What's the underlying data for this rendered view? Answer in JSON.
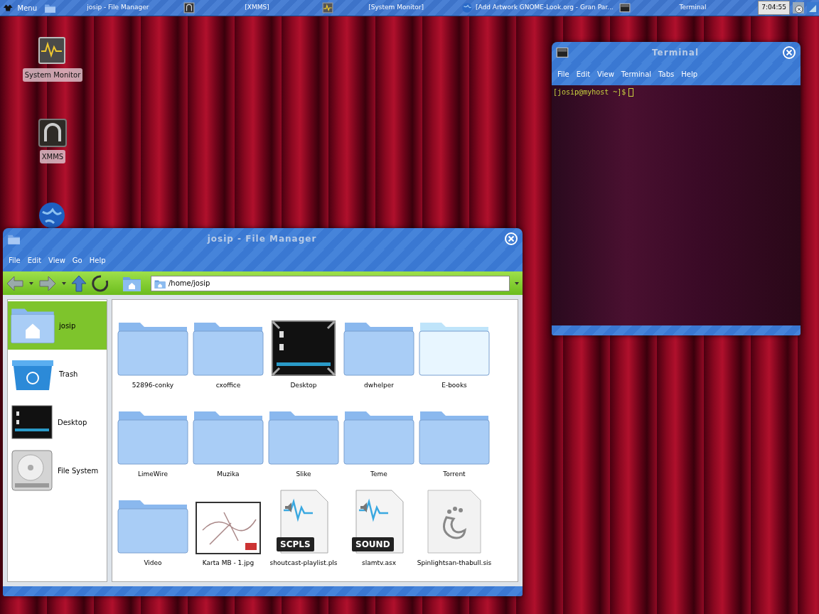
{
  "taskbar": {
    "menu": "Menu",
    "tasks": [
      {
        "label": "josip - File Manager"
      },
      {
        "label": "[XMMS]"
      },
      {
        "label": "[System Monitor]"
      },
      {
        "label": "[Add Artwork GNOME-Look.org - Gran Par..."
      },
      {
        "label": "Terminal"
      }
    ],
    "clock": "7:04:55"
  },
  "desktop_icons": [
    {
      "label": "System Monitor"
    },
    {
      "label": "XMMS"
    }
  ],
  "terminal": {
    "title": "Terminal",
    "menu": [
      "File",
      "Edit",
      "View",
      "Terminal",
      "Tabs",
      "Help"
    ],
    "prompt": "[josip@myhost ~]$"
  },
  "file_manager": {
    "title": "josip - File Manager",
    "menu": [
      "File",
      "Edit",
      "View",
      "Go",
      "Help"
    ],
    "location": "/home/josip",
    "places": [
      {
        "label": "josip",
        "selected": true
      },
      {
        "label": "Trash",
        "selected": false
      },
      {
        "label": "Desktop",
        "selected": false
      },
      {
        "label": "File System",
        "selected": false
      }
    ],
    "files": [
      {
        "name": "52896-conky",
        "kind": "folder"
      },
      {
        "name": "cxoffice",
        "kind": "folder"
      },
      {
        "name": "Desktop",
        "kind": "desktop"
      },
      {
        "name": "dwhelper",
        "kind": "folder"
      },
      {
        "name": "E-books",
        "kind": "folder-light"
      },
      {
        "name": "LimeWire",
        "kind": "folder"
      },
      {
        "name": "Muzika",
        "kind": "folder"
      },
      {
        "name": "Slike",
        "kind": "folder"
      },
      {
        "name": "Teme",
        "kind": "folder"
      },
      {
        "name": "Torrent",
        "kind": "folder"
      },
      {
        "name": "Video",
        "kind": "folder"
      },
      {
        "name": "Karta MB - 1.jpg",
        "kind": "image"
      },
      {
        "name": "shoutcast-playlist.pls",
        "kind": "audio",
        "badge": "SCPLS"
      },
      {
        "name": "slamtv.asx",
        "kind": "audio",
        "badge": "SOUND"
      },
      {
        "name": "Spinlightsan-thabull.sis",
        "kind": "gnome"
      }
    ]
  }
}
